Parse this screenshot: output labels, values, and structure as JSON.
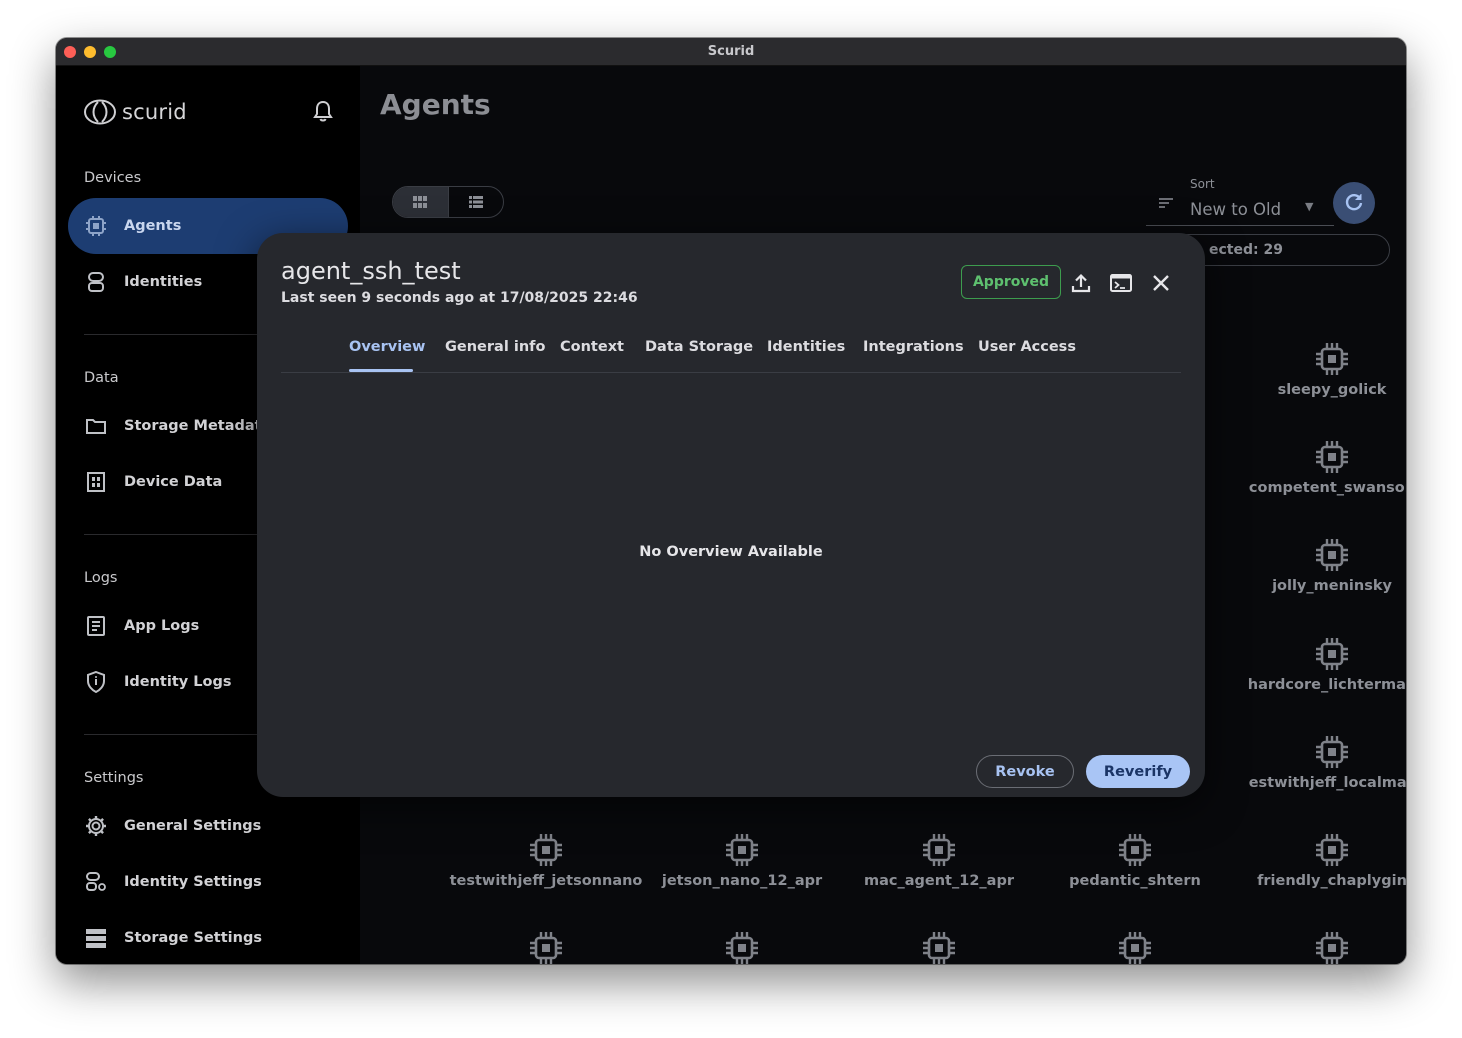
{
  "window": {
    "title": "Scurid"
  },
  "sidebar": {
    "logo_text": "scurid",
    "sections": {
      "devices": "Devices",
      "data": "Data",
      "logs": "Logs",
      "settings": "Settings"
    },
    "items": {
      "agents": "Agents",
      "identities": "Identities",
      "storage_metadata": "Storage Metadata",
      "device_data": "Device Data",
      "app_logs": "App Logs",
      "identity_logs": "Identity Logs",
      "general_settings": "General Settings",
      "identity_settings": "Identity Settings",
      "storage_settings": "Storage Settings"
    }
  },
  "main": {
    "title": "Agents",
    "sort": {
      "label": "Sort",
      "value": "New to Old"
    },
    "selected_text": "ected: 29",
    "agents_right_column": [
      "sleepy_golick",
      "competent_swanson",
      "jolly_meninsky",
      "hardcore_lichterman",
      "estwithjeff_localmac"
    ],
    "agents_bottom_row": [
      "testwithjeff_jetsonnano",
      "jetson_nano_12_apr",
      "mac_agent_12_apr",
      "pedantic_shtern",
      "friendly_chaplygin"
    ]
  },
  "modal": {
    "title": "agent_ssh_test",
    "subtitle": "Last seen 9 seconds ago at 17/08/2025 22:46",
    "status": "Approved",
    "tabs": [
      "Overview",
      "General info",
      "Context",
      "Data Storage",
      "Identities",
      "Integrations",
      "User Access"
    ],
    "active_tab": "Overview",
    "empty_message": "No Overview Available",
    "revoke_label": "Revoke",
    "reverify_label": "Reverify"
  },
  "colors": {
    "accent": "#a8c3f2",
    "active_nav": "#1d3d72",
    "approved": "#5ec06f",
    "modal_bg": "#26282d",
    "sidebar_bg": "#000000"
  }
}
